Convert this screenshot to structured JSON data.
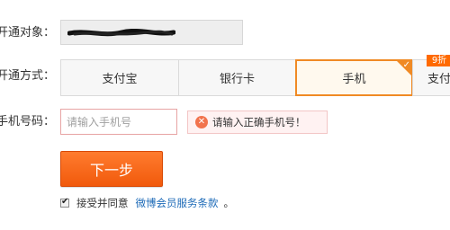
{
  "form": {
    "row_target": {
      "label": "开通对象："
    },
    "row_method": {
      "label": "开通方式：",
      "tabs": [
        {
          "label": "支付宝"
        },
        {
          "label": "银行卡"
        },
        {
          "label": "手机",
          "selected": true
        },
        {
          "label": "支付"
        }
      ],
      "badge": "9折"
    },
    "row_phone": {
      "label": "手机号码：",
      "placeholder": "请输入手机号",
      "error": "请输入正确手机号！"
    },
    "next_button": "下一步",
    "agreement": {
      "text": "接受并同意",
      "link": "微博会员服务条款",
      "period": "。",
      "checked": true
    }
  },
  "colors": {
    "accent": "#f08a24",
    "button": "#f15a0c",
    "link": "#1e6bb8",
    "error_icon": "#f2734d"
  }
}
